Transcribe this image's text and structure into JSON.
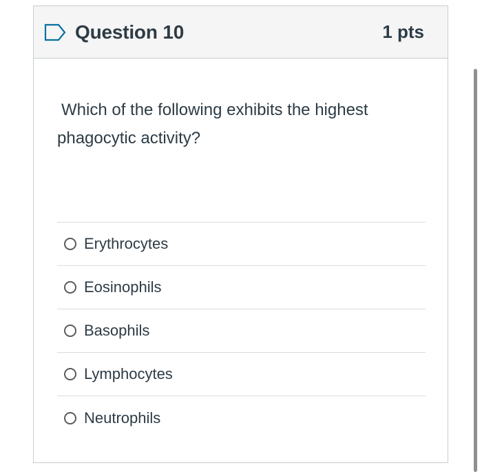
{
  "question": {
    "title": "Question 10",
    "points": "1 pts",
    "flag_icon": "flag-outline-icon",
    "text": "Which of the following exhibits the highest phagocytic activity?"
  },
  "answers": [
    {
      "label": "Erythrocytes",
      "selected": false
    },
    {
      "label": "Eosinophils",
      "selected": false
    },
    {
      "label": "Basophils",
      "selected": false
    },
    {
      "label": "Lymphocytes",
      "selected": false
    },
    {
      "label": "Neutrophils",
      "selected": false
    }
  ],
  "colors": {
    "text": "#2d3b45",
    "header_bg": "#f5f5f5",
    "border": "#c7cdd1",
    "flag": "#0770a3"
  }
}
